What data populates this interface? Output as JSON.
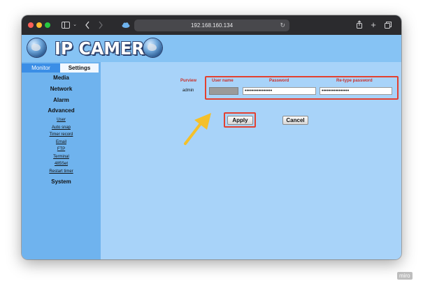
{
  "browser": {
    "url": "192.168.160.134",
    "reload_icon": "↻"
  },
  "banner": {
    "title": "IP CAMERA"
  },
  "tabs": {
    "monitor": "Monitor",
    "settings": "Settings"
  },
  "sidebar": {
    "sections": {
      "media": "Media",
      "network": "Network",
      "alarm": "Alarm",
      "advanced": "Advanced",
      "system": "System"
    },
    "advanced_items": [
      "User",
      "Auto snap",
      "Timer record",
      "Email",
      "FTP",
      "Terminal",
      "485Set",
      "Restart timer"
    ]
  },
  "form": {
    "headers": {
      "purview": "Purview",
      "username": "User name",
      "password": "Password",
      "retype": "Re-type password"
    },
    "row": {
      "purview": "admin",
      "password": "••••••••••••••••",
      "retype": "••••••••••••••••"
    }
  },
  "buttons": {
    "apply": "Apply",
    "cancel": "Cancel"
  },
  "annotation": {
    "highlight_color": "#e3402f",
    "arrow_color": "#f4c02a"
  },
  "watermark": "miro"
}
